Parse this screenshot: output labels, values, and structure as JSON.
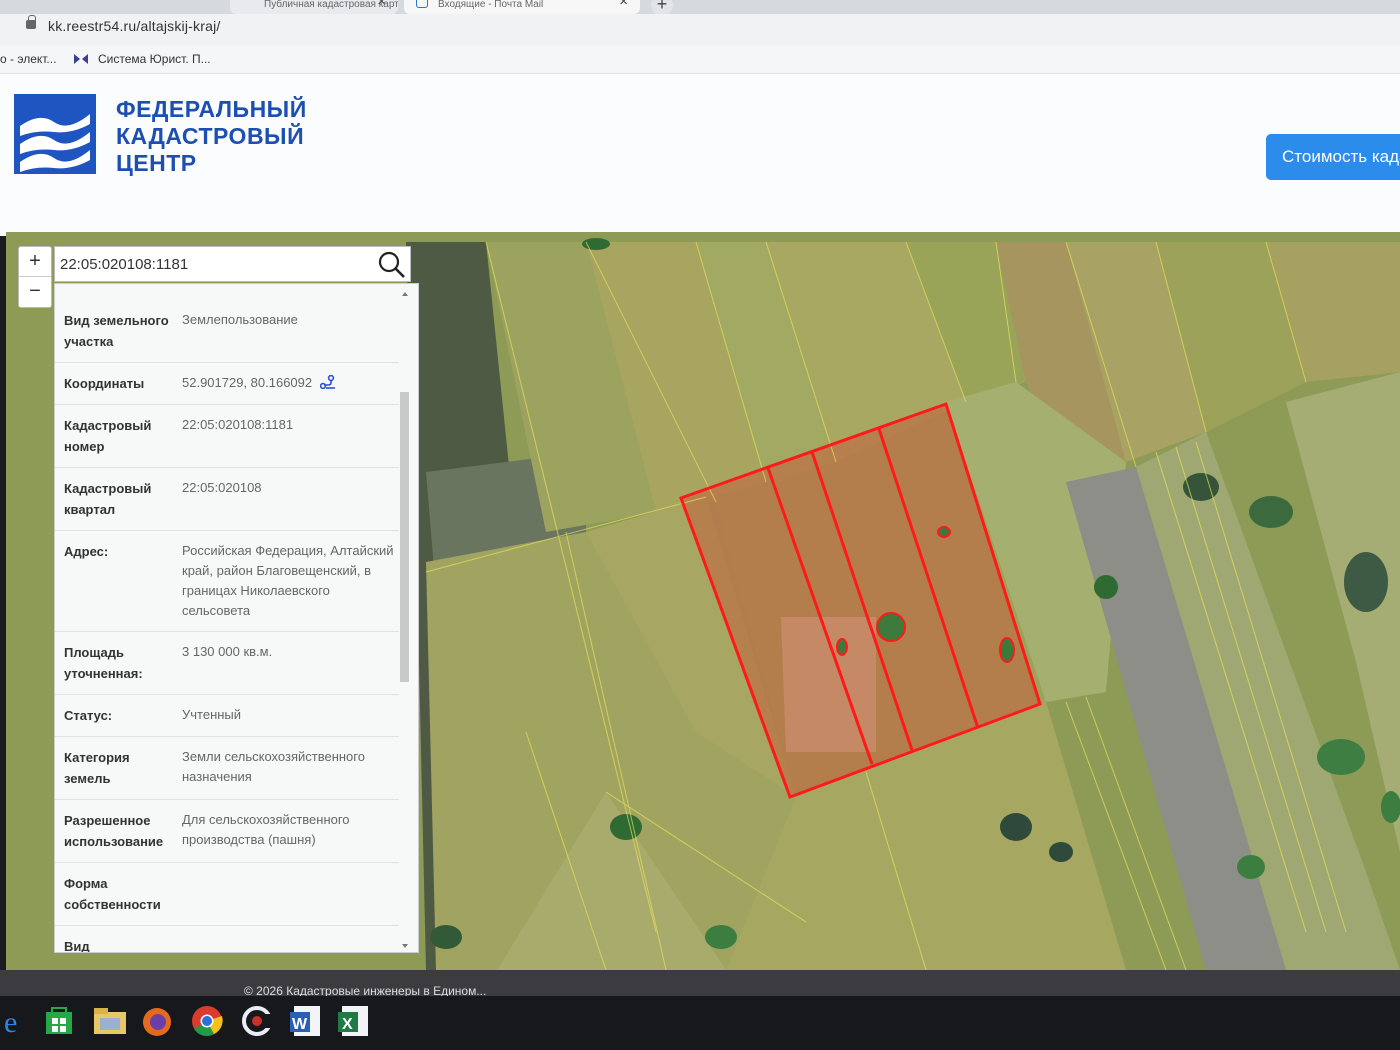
{
  "browser": {
    "tabs": [
      {
        "label": "Публичная кадастровая карта"
      },
      {
        "label": "Входящие - Почта Mail"
      }
    ],
    "new_tab_label": "+",
    "url": "kk.reestr54.ru/altajskij-kraj/",
    "bookmarks": [
      {
        "label": "о - элект..."
      },
      {
        "label": "Система Юрист. П..."
      }
    ]
  },
  "site": {
    "logo_lines": [
      "ФЕДЕРАЛЬНЫЙ",
      "КАДАСТРОВЫЙ",
      "ЦЕНТР"
    ],
    "cost_button_label": "Стоимость кадастровых работ"
  },
  "map": {
    "zoom_in_label": "+",
    "zoom_out_label": "−",
    "search_value": "22:05:020108:1181",
    "highlight_color": "#ff1a1a"
  },
  "info_panel": {
    "rows": [
      {
        "label": "Вид земельного участка",
        "value": "Землепользование"
      },
      {
        "label": "Координаты",
        "value": "52.901729, 80.166092"
      },
      {
        "label": "Кадастровый номер",
        "value": "22:05:020108:1181"
      },
      {
        "label": "Кадастровый квартал",
        "value": "22:05:020108"
      },
      {
        "label": "Адрес:",
        "value": "Российская Федерация, Алтайский край, район Благовещенский, в границах Николаевского сельсовета"
      },
      {
        "label": "Площадь уточненная:",
        "value": "3 130 000 кв.м."
      },
      {
        "label": "Статус:",
        "value": "Учтенный"
      },
      {
        "label": "Категория земель",
        "value": "Земли сельскохозяйственного назначения"
      },
      {
        "label": "Разрешенное использование",
        "value": "Для сельскохозяйственного производства (пашня)"
      },
      {
        "label": "Форма собственности",
        "value": ""
      },
      {
        "label": "Вид",
        "value": ""
      }
    ]
  },
  "footer": {
    "copyright": "© 2026 Кадастровые инженеры в Едином..."
  }
}
